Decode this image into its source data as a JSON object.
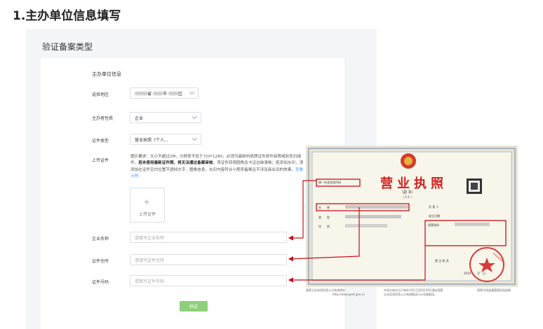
{
  "page": {
    "title": "1.主办单位信息填写"
  },
  "panel": {
    "title": "验证备案类型"
  },
  "form": {
    "section_title": "主办单位信息",
    "region": {
      "label": "选择地区",
      "province_suffix": "省",
      "city_suffix": "市",
      "district_suffix": "区"
    },
    "nature": {
      "label": "主办者性质",
      "value": "企业"
    },
    "cert_type": {
      "label": "证件类型",
      "value": "营业执照（个人..."
    },
    "upload": {
      "label": "上传证件",
      "hint_part1": "图片要求：大小不超过2M，分辨率不低于720*1280，必须为最新的纸质证件原件拍照或彩色扫描件，",
      "hint_bold": "若未使用最新证件照，将无法通过备案审核",
      "hint_part2": "；须证件四周圆角及卡证边缘清晰；若添加水印，须添加在证件空白位置不遮挡文字、图像信息，水印内容符合小程序备案且不涉及商业目的效果。",
      "hint_link": "查看示例",
      "plus": "+",
      "button_label": "上传证件"
    },
    "company_name": {
      "label": "企业名称",
      "placeholder": "请填写企业名称"
    },
    "cert_address": {
      "label": "证件住所",
      "placeholder": "请填写证件住所"
    },
    "cert_number": {
      "label": "证件号码",
      "placeholder": "请填写证件号码"
    },
    "submit_label": "验证"
  },
  "license": {
    "title": "营业执照",
    "subtitle": "（副 本）",
    "copy_no": "（ 1-1 ）",
    "credit_code_label": "统一社会信用代码",
    "name_label": "名　　称",
    "type_label": "类　　型",
    "residence_label": "住　　所",
    "legal_rep_label": "负 责 人",
    "found_date_label": "成立日期",
    "address_label": "经营场所",
    "reg_authority_label": "登 记 机 关",
    "year": "2024",
    "month_day": "月　日",
    "seal_text": "市场监督管理局",
    "footer_left": "国家企业信用信息公示系统网址：",
    "footer_url": "http://www.gsxt.gov.cn",
    "footer_mid1": "市场主体应当于每年1月1日至6月30日通过国家",
    "footer_mid2": "企业信用信息公示系统报送公示年度报告。",
    "footer_right": "国家市场监督管理总局监制"
  },
  "colors": {
    "accent_red": "#c8101d",
    "license_title_red": "#d0201e",
    "border_blue": "#8f9fb6",
    "button_green": "#8fcf7b",
    "link_blue": "#409eff"
  }
}
